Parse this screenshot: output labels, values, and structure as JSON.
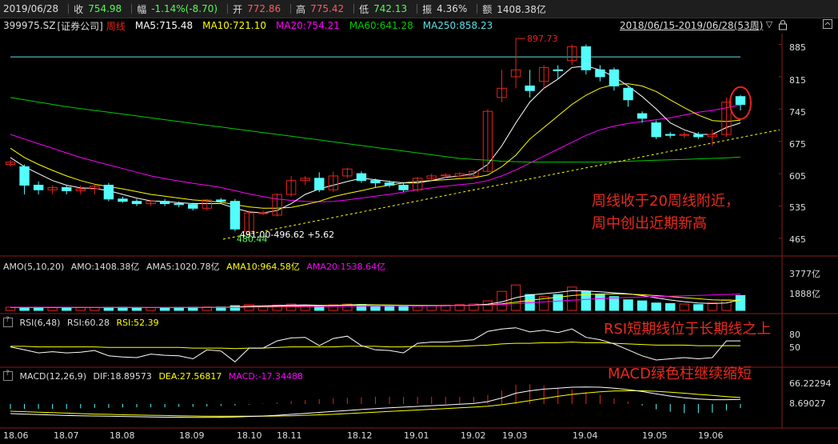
{
  "quote": {
    "date": "2019/06/28",
    "close_label": "收",
    "close": "754.98",
    "change_label": "幅",
    "change": "-1.14%(-8.70)",
    "open_label": "开",
    "open": "772.86",
    "high_label": "高",
    "high": "775.42",
    "low_label": "低",
    "low": "742.13",
    "amp_label": "振",
    "amp": "4.36%",
    "amount_label": "额",
    "amount": "1408.38亿"
  },
  "legend": {
    "code": "399975.SZ",
    "name": "[证券公司]",
    "period": "周线",
    "ma5": "MA5:715.48",
    "ma10": "MA10:721.10",
    "ma20": "MA20:754.21",
    "ma60": "MA60:641.28",
    "ma250": "MA250:858.23",
    "range": "2018/06/15-2019/06/28(53周)",
    "range_arrow": "▽",
    "lock_icon": "lock-icon",
    "expand_icon": "expand-icon"
  },
  "amo_legend": {
    "title": "AMO(5,10,20)",
    "amo": "AMO:1408.38亿",
    "ama5": "AMA5:1020.78亿",
    "ama10": "AMA10:964.58亿",
    "ama20": "AMA20:1538.64亿"
  },
  "rsi_legend": {
    "title": "RSI(6,48)",
    "rsi1": "RSI:60.28",
    "rsi2": "RSI:52.39"
  },
  "macd_legend": {
    "title": "MACD(12,26,9)",
    "dif": "DIF:18.89573",
    "dea": "DEA:27.56817",
    "macd": "MACD:-17.34488"
  },
  "annotations": {
    "line1": "周线收于20周线附近，",
    "line2": "周中创出近期新高",
    "rsi": "RSI短期线位于长期线之上",
    "macd": "MACD绿色柱继续缩短"
  },
  "colors": {
    "up": "#e8231c",
    "down": "#54fcfc",
    "ma5": "#ffffff",
    "ma10": "#ffff00",
    "ma20": "#ff00ff",
    "ma60": "#00cc00",
    "ma250": "#5ce1e6",
    "annotation": "#e82a1d"
  },
  "chart_data": {
    "type": "candlestick",
    "x_labels": [
      "18.06",
      "18.07",
      "18.08",
      "18.09",
      "18.10",
      "18.11",
      "18.12",
      "19.01",
      "19.02",
      "19.03",
      "19.04",
      "19.05",
      "19.06"
    ],
    "y_ticks": [
      "885",
      "815",
      "745",
      "675",
      "605",
      "535",
      "465"
    ],
    "y_range": [
      430,
      905
    ],
    "high_marker": "897.73",
    "low_marker": "480.44",
    "low_note": "491.00-496.62  +5.62",
    "candles": [
      [
        625,
        630,
        620,
        635
      ],
      [
        620,
        580,
        560,
        625
      ],
      [
        580,
        570,
        560,
        588
      ],
      [
        570,
        575,
        560,
        580
      ],
      [
        575,
        568,
        560,
        580
      ],
      [
        568,
        572,
        560,
        580
      ],
      [
        572,
        578,
        560,
        582
      ],
      [
        580,
        550,
        545,
        585
      ],
      [
        550,
        545,
        542,
        555
      ],
      [
        545,
        540,
        535,
        550
      ],
      [
        540,
        545,
        535,
        548
      ],
      [
        545,
        540,
        535,
        550
      ],
      [
        540,
        538,
        532,
        545
      ],
      [
        538,
        530,
        525,
        542
      ],
      [
        530,
        548,
        525,
        550
      ],
      [
        548,
        545,
        540,
        552
      ],
      [
        545,
        485,
        480,
        550
      ],
      [
        480,
        520,
        475,
        525
      ],
      [
        520,
        520,
        515,
        525
      ],
      [
        515,
        560,
        512,
        562
      ],
      [
        560,
        590,
        555,
        600
      ],
      [
        590,
        595,
        580,
        600
      ],
      [
        595,
        570,
        565,
        608
      ],
      [
        570,
        600,
        565,
        610
      ],
      [
        600,
        615,
        595,
        618
      ],
      [
        605,
        590,
        585,
        610
      ],
      [
        590,
        585,
        575,
        594
      ],
      [
        585,
        580,
        575,
        590
      ],
      [
        580,
        570,
        565,
        585
      ],
      [
        570,
        595,
        565,
        598
      ],
      [
        595,
        600,
        590,
        605
      ],
      [
        600,
        602,
        596,
        606
      ],
      [
        600,
        605,
        596,
        608
      ],
      [
        600,
        610,
        595,
        612
      ],
      [
        610,
        740,
        608,
        745
      ],
      [
        770,
        790,
        760,
        830
      ],
      [
        815,
        830,
        790,
        898
      ],
      [
        795,
        785,
        770,
        830
      ],
      [
        805,
        835,
        790,
        840
      ],
      [
        830,
        828,
        810,
        840
      ],
      [
        850,
        880,
        840,
        885
      ],
      [
        880,
        830,
        820,
        885
      ],
      [
        830,
        815,
        805,
        840
      ],
      [
        830,
        795,
        785,
        835
      ],
      [
        790,
        765,
        750,
        795
      ],
      [
        735,
        725,
        715,
        740
      ],
      [
        715,
        685,
        680,
        720
      ],
      [
        690,
        688,
        682,
        695
      ],
      [
        688,
        690,
        682,
        695
      ],
      [
        690,
        685,
        680,
        695
      ],
      [
        685,
        690,
        665,
        700
      ],
      [
        690,
        760,
        685,
        770
      ],
      [
        772,
        755,
        742,
        775
      ]
    ],
    "ma5": [
      640,
      620,
      605,
      590,
      580,
      574,
      573,
      568,
      560,
      552,
      546,
      545,
      542,
      540,
      540,
      540,
      530,
      522,
      520,
      525,
      540,
      560,
      572,
      580,
      588,
      595,
      592,
      588,
      585,
      585,
      590,
      597,
      600,
      605,
      625,
      665,
      715,
      760,
      790,
      810,
      835,
      838,
      830,
      815,
      795,
      772,
      745,
      715,
      700,
      690,
      690,
      705,
      715
    ],
    "ma10": [
      660,
      640,
      625,
      612,
      600,
      590,
      582,
      577,
      572,
      566,
      560,
      556,
      552,
      548,
      546,
      543,
      538,
      533,
      530,
      530,
      532,
      538,
      545,
      555,
      562,
      568,
      575,
      580,
      585,
      588,
      590,
      592,
      594,
      596,
      602,
      620,
      645,
      680,
      705,
      730,
      755,
      775,
      790,
      798,
      800,
      795,
      783,
      765,
      748,
      732,
      720,
      718,
      721
    ],
    "ma20": [
      690,
      680,
      670,
      660,
      650,
      640,
      632,
      624,
      616,
      608,
      600,
      594,
      589,
      584,
      580,
      575,
      568,
      561,
      555,
      550,
      547,
      545,
      544,
      545,
      548,
      552,
      556,
      560,
      565,
      570,
      574,
      578,
      581,
      584,
      590,
      600,
      613,
      628,
      643,
      658,
      673,
      688,
      700,
      708,
      714,
      718,
      722,
      726,
      732,
      738,
      742,
      748,
      754
    ],
    "ma60": [
      770,
      765,
      760,
      755,
      750,
      746,
      742,
      738,
      734,
      730,
      726,
      722,
      718,
      714,
      710,
      706,
      702,
      698,
      694,
      690,
      686,
      682,
      678,
      674,
      670,
      666,
      662,
      658,
      654,
      650,
      646,
      642,
      638,
      636,
      634,
      632,
      631,
      630,
      630,
      630,
      630,
      630,
      630,
      631,
      632,
      633,
      634,
      635,
      636,
      637,
      638,
      639,
      641
    ],
    "ma250": [
      858,
      858,
      858,
      858,
      858,
      858,
      858,
      858,
      858,
      858,
      858,
      858,
      858,
      858,
      858,
      858,
      858,
      858,
      858,
      858,
      858,
      858,
      858,
      858,
      858,
      858,
      858,
      858,
      858,
      858,
      858,
      858,
      858,
      858,
      858,
      858,
      858,
      858,
      858,
      858,
      858,
      858,
      858,
      858,
      858,
      858,
      858,
      858,
      858,
      858,
      858,
      858,
      858
    ],
    "amo": {
      "y_ticks": [
        "3777亿",
        "1888亿"
      ],
      "y_max": 3777,
      "values": [
        300,
        250,
        280,
        250,
        270,
        260,
        280,
        280,
        300,
        250,
        260,
        260,
        280,
        300,
        320,
        320,
        450,
        550,
        400,
        500,
        600,
        450,
        420,
        520,
        600,
        550,
        400,
        380,
        380,
        400,
        450,
        500,
        550,
        600,
        900,
        1800,
        2400,
        1500,
        1300,
        1500,
        2200,
        1800,
        1500,
        1300,
        1000,
        900,
        700,
        650,
        600,
        550,
        700,
        1000,
        1408
      ],
      "ama5": [
        280,
        275,
        275,
        270,
        268,
        265,
        268,
        270,
        275,
        270,
        268,
        265,
        268,
        272,
        280,
        290,
        330,
        390,
        420,
        450,
        500,
        520,
        480,
        470,
        520,
        550,
        530,
        490,
        450,
        420,
        420,
        440,
        460,
        500,
        580,
        800,
        1200,
        1460,
        1580,
        1700,
        1860,
        1840,
        1760,
        1660,
        1560,
        1400,
        1180,
        980,
        820,
        700,
        650,
        700,
        1020
      ],
      "ama10": [
        290,
        285,
        282,
        280,
        278,
        276,
        275,
        274,
        274,
        272,
        270,
        270,
        270,
        272,
        276,
        280,
        300,
        330,
        360,
        390,
        420,
        440,
        450,
        460,
        480,
        500,
        510,
        505,
        490,
        480,
        470,
        470,
        475,
        480,
        520,
        620,
        780,
        950,
        1100,
        1250,
        1400,
        1500,
        1550,
        1560,
        1540,
        1480,
        1400,
        1300,
        1200,
        1100,
        1000,
        970,
        965
      ],
      "ama20": [
        300,
        298,
        296,
        294,
        292,
        290,
        288,
        286,
        285,
        284,
        283,
        282,
        282,
        282,
        284,
        286,
        290,
        300,
        310,
        320,
        335,
        350,
        365,
        380,
        395,
        410,
        420,
        425,
        430,
        435,
        440,
        450,
        460,
        470,
        500,
        560,
        640,
        720,
        800,
        880,
        960,
        1040,
        1110,
        1170,
        1220,
        1260,
        1300,
        1340,
        1380,
        1420,
        1460,
        1500,
        1538
      ]
    },
    "rsi": {
      "y_ticks": [
        "80",
        "50"
      ],
      "rsi6": [
        50,
        45,
        40,
        42,
        40,
        41,
        44,
        35,
        33,
        32,
        38,
        36,
        35,
        30,
        45,
        43,
        25,
        48,
        48,
        60,
        65,
        66,
        52,
        64,
        68,
        52,
        45,
        44,
        40,
        56,
        58,
        58,
        60,
        62,
        76,
        80,
        82,
        75,
        78,
        74,
        80,
        66,
        62,
        55,
        45,
        35,
        28,
        30,
        32,
        30,
        32,
        60,
        60
      ],
      "rsi48": [
        51,
        51,
        50,
        50,
        50,
        50,
        50,
        49,
        49,
        49,
        49,
        49,
        49,
        48,
        48,
        48,
        47,
        48,
        48,
        49,
        50,
        50,
        50,
        50,
        51,
        51,
        51,
        50,
        50,
        51,
        51,
        51,
        51,
        52,
        53,
        55,
        56,
        56,
        57,
        57,
        58,
        57,
        57,
        56,
        55,
        54,
        53,
        53,
        53,
        52,
        52,
        52,
        52
      ]
    },
    "macd": {
      "y_ticks": [
        "66.22294",
        "8.69027"
      ],
      "dif": [
        -40,
        -42,
        -44,
        -46,
        -48,
        -49,
        -50,
        -51,
        -52,
        -53,
        -54,
        -55,
        -55,
        -56,
        -56,
        -55,
        -54,
        -52,
        -50,
        -47,
        -43,
        -39,
        -35,
        -31,
        -27,
        -23,
        -19,
        -16,
        -13,
        -10,
        -7,
        -4,
        -1,
        2,
        10,
        25,
        45,
        55,
        62,
        66,
        70,
        71,
        70,
        66,
        60,
        52,
        42,
        33,
        26,
        21,
        18,
        18,
        19
      ],
      "dea": [
        -30,
        -32,
        -34,
        -36,
        -38,
        -40,
        -42,
        -43,
        -45,
        -46,
        -47,
        -48,
        -49,
        -50,
        -51,
        -51,
        -51,
        -51,
        -51,
        -50,
        -49,
        -47,
        -45,
        -43,
        -40,
        -37,
        -34,
        -31,
        -28,
        -25,
        -22,
        -19,
        -16,
        -13,
        -9,
        -3,
        5,
        14,
        23,
        32,
        40,
        46,
        51,
        54,
        55,
        55,
        53,
        49,
        45,
        40,
        36,
        31,
        27
      ],
      "hist": [
        -20,
        -20,
        -20,
        -20,
        -20,
        -18,
        -16,
        -16,
        -14,
        -14,
        -14,
        -14,
        -12,
        -12,
        -10,
        -8,
        -6,
        -2,
        2,
        6,
        12,
        16,
        20,
        24,
        26,
        28,
        30,
        30,
        30,
        30,
        30,
        30,
        30,
        30,
        38,
        56,
        80,
        82,
        78,
        68,
        60,
        50,
        38,
        24,
        10,
        -6,
        -22,
        -32,
        -38,
        -38,
        -36,
        -26,
        -17
      ]
    }
  }
}
